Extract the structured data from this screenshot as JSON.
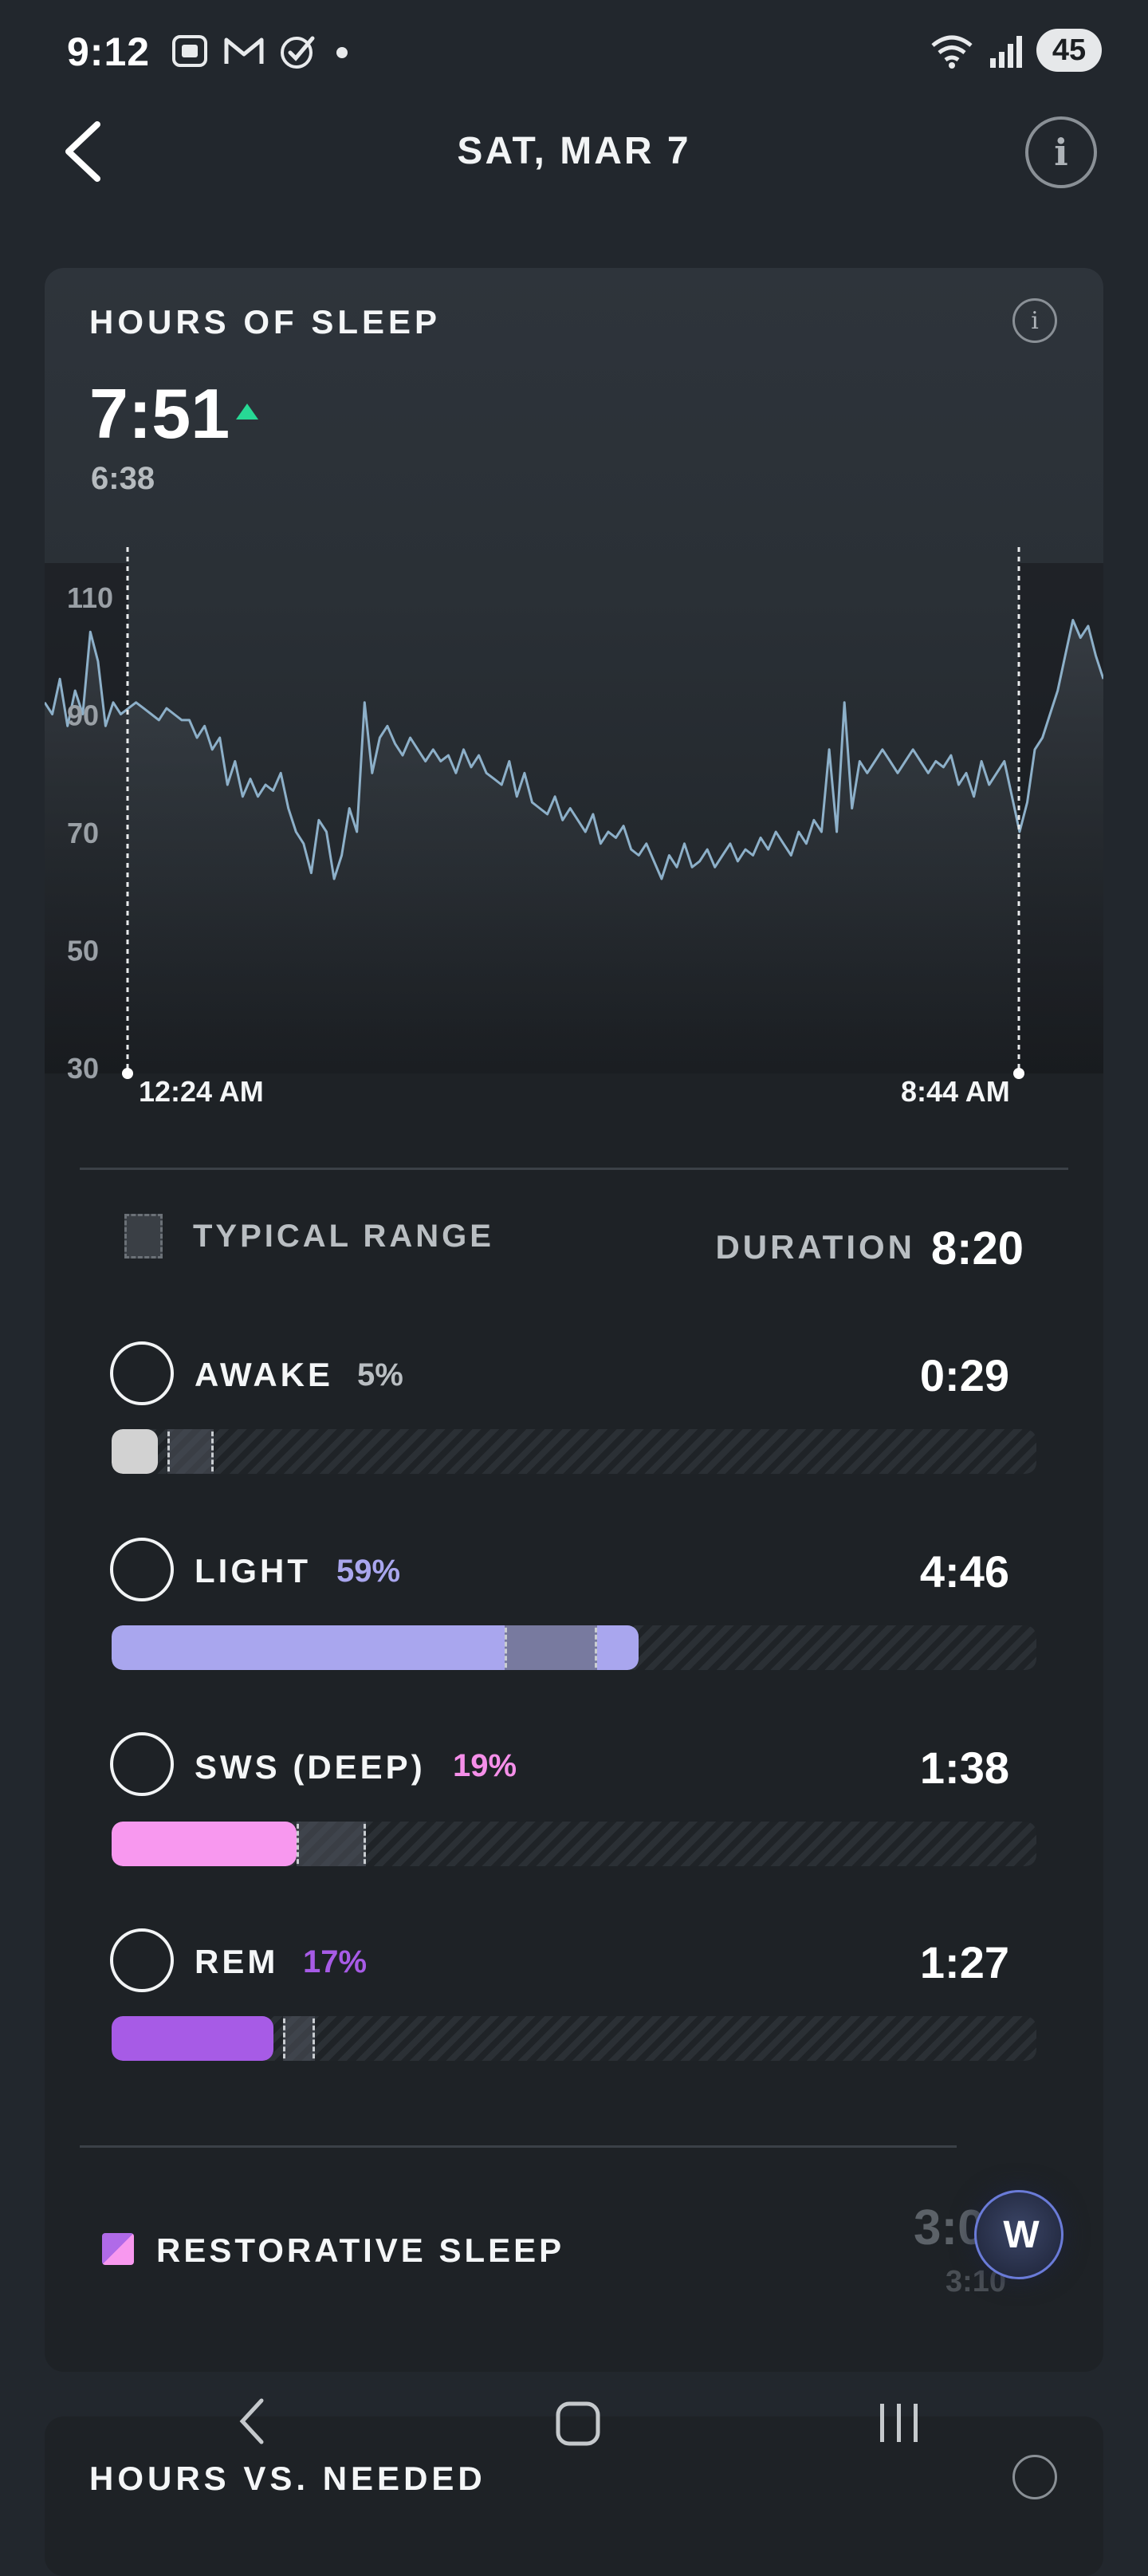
{
  "status_bar": {
    "time": "9:12",
    "battery": "45"
  },
  "header": {
    "title": "SAT, MAR 7"
  },
  "sleep_card": {
    "title": "HOURS OF SLEEP",
    "hours": "7:51",
    "previous": "6:38",
    "trend": "up",
    "trend_color": "#27d995"
  },
  "chart_data": {
    "type": "line",
    "y_ticks": [
      "110",
      "90",
      "70",
      "50",
      "30"
    ],
    "ylim": [
      30,
      110
    ],
    "start_time": "12:24 AM",
    "end_time": "8:44 AM",
    "series": [
      {
        "color": "#8db0c9",
        "values": [
          92,
          90,
          96,
          88,
          94,
          90,
          104,
          99,
          88,
          92,
          90,
          91,
          92,
          91,
          90,
          89,
          91,
          90,
          89,
          89,
          86,
          88,
          84,
          86,
          78,
          82,
          76,
          79,
          76,
          78,
          77,
          80,
          74,
          70,
          68,
          63,
          72,
          70,
          62,
          66,
          74,
          70,
          92,
          80,
          86,
          88,
          85,
          83,
          86,
          84,
          82,
          84,
          82,
          83,
          80,
          84,
          81,
          83,
          80,
          79,
          78,
          82,
          76,
          80,
          75,
          74,
          73,
          76,
          72,
          74,
          72,
          70,
          73,
          68,
          70,
          69,
          71,
          67,
          66,
          68,
          65,
          62,
          66,
          64,
          68,
          64,
          65,
          67,
          64,
          66,
          68,
          65,
          67,
          66,
          69,
          67,
          70,
          68,
          66,
          70,
          68,
          72,
          70,
          84,
          70,
          92,
          74,
          82,
          80,
          82,
          84,
          82,
          80,
          82,
          84,
          82,
          80,
          82,
          81,
          83,
          78,
          80,
          76,
          82,
          78,
          80,
          82,
          76,
          70,
          75,
          84,
          86,
          90,
          94,
          100,
          106,
          103,
          105,
          100,
          96
        ]
      }
    ],
    "legend": {
      "typical_range_label": "TYPICAL RANGE",
      "duration_label": "DURATION",
      "duration": "8:20"
    },
    "stages": [
      {
        "name": "AWAKE",
        "pct_label": "5%",
        "pct": 0.05,
        "time": "0:29",
        "color": "#d2d2d2",
        "pct_color": "#b9bec2",
        "typical_start": 0.06,
        "typical_end": 0.11
      },
      {
        "name": "LIGHT",
        "pct_label": "59%",
        "pct": 0.57,
        "time": "4:46",
        "color": "#a9a6ee",
        "pct_color": "#a9a6ee",
        "typical_start": 0.425,
        "typical_end": 0.525
      },
      {
        "name": "SWS (DEEP)",
        "pct_label": "19%",
        "pct": 0.2,
        "time": "1:38",
        "color": "#f898ef",
        "pct_color": "#f58fe9",
        "typical_start": 0.2,
        "typical_end": 0.275
      },
      {
        "name": "REM",
        "pct_label": "17%",
        "pct": 0.175,
        "time": "1:27",
        "color": "#a75be6",
        "pct_color": "#a75be6",
        "typical_start": 0.185,
        "typical_end": 0.22
      }
    ]
  },
  "restorative": {
    "label": "RESTORATIVE SLEEP",
    "value": "3:0",
    "sub": "3:10"
  },
  "fab": {
    "label": "W"
  },
  "next_card": {
    "title": "HOURS VS. NEEDED"
  }
}
